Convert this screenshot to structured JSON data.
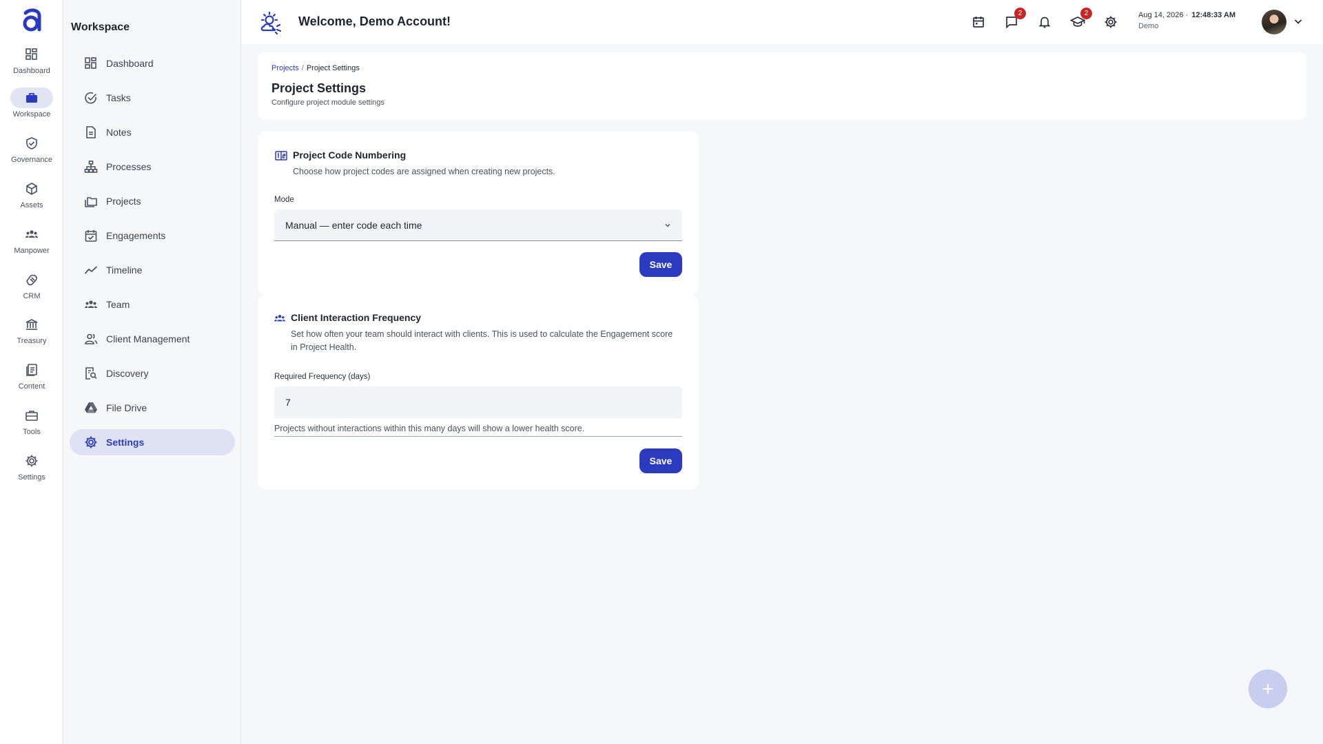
{
  "rail": {
    "items": [
      {
        "label": "Dashboard",
        "icon": "dashboard-icon"
      },
      {
        "label": "Workspace",
        "icon": "briefcase-icon",
        "active": true
      },
      {
        "label": "Governance",
        "icon": "shield-check-icon"
      },
      {
        "label": "Assets",
        "icon": "cube-icon"
      },
      {
        "label": "Manpower",
        "icon": "people-icon"
      },
      {
        "label": "CRM",
        "icon": "handshake-icon"
      },
      {
        "label": "Treasury",
        "icon": "bank-icon"
      },
      {
        "label": "Content",
        "icon": "documents-icon"
      },
      {
        "label": "Tools",
        "icon": "toolbox-icon"
      },
      {
        "label": "Settings",
        "icon": "gear-icon"
      }
    ]
  },
  "sidebar": {
    "title": "Workspace",
    "items": [
      {
        "label": "Dashboard",
        "icon": "dashboard-icon"
      },
      {
        "label": "Tasks",
        "icon": "task-check-icon"
      },
      {
        "label": "Notes",
        "icon": "note-icon"
      },
      {
        "label": "Processes",
        "icon": "org-chart-icon"
      },
      {
        "label": "Projects",
        "icon": "folders-icon"
      },
      {
        "label": "Engagements",
        "icon": "calendar-check-icon"
      },
      {
        "label": "Timeline",
        "icon": "trend-line-icon"
      },
      {
        "label": "Team",
        "icon": "team-icon"
      },
      {
        "label": "Client Management",
        "icon": "client-icon"
      },
      {
        "label": "Discovery",
        "icon": "search-document-icon"
      },
      {
        "label": "File Drive",
        "icon": "drive-icon"
      },
      {
        "label": "Settings",
        "icon": "gear-icon",
        "active": true
      }
    ]
  },
  "topbar": {
    "welcome": "Welcome, Demo Account!",
    "messages_badge": "2",
    "academy_badge": "2",
    "date": "Aug 14, 2026 ·",
    "time": "12:48:33 AM",
    "user": "Demo"
  },
  "header": {
    "breadcrumb_link": "Projects",
    "breadcrumb_sep": "/",
    "breadcrumb_current": "Project Settings",
    "title": "Project Settings",
    "subtitle": "Configure project module settings"
  },
  "code_card": {
    "title": "Project Code Numbering",
    "description": "Choose how project codes are assigned when creating new projects.",
    "mode_label": "Mode",
    "mode_value": "Manual — enter code each time",
    "save_label": "Save"
  },
  "freq_card": {
    "title": "Client Interaction Frequency",
    "description": "Set how often your team should interact with clients. This is used to calculate the Engagement score in Project Health.",
    "field_label": "Required Frequency (days)",
    "field_value": "7",
    "helper": "Projects without interactions within this many days will show a lower health score.",
    "save_label": "Save"
  },
  "colors": {
    "accent": "#2b3bbd",
    "badge": "#c62828",
    "active_bg": "#dfe2f2"
  }
}
